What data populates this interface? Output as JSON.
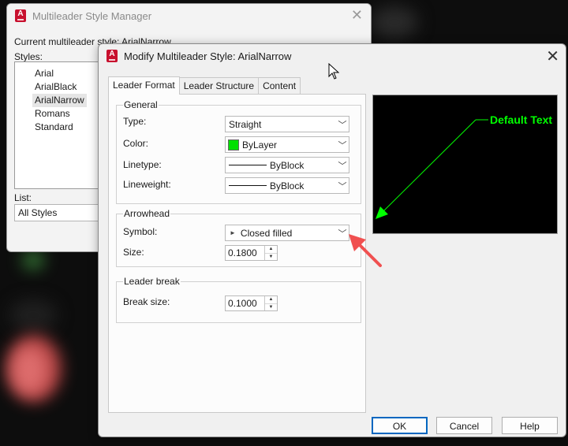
{
  "back_window": {
    "title": "Multileader Style Manager",
    "current_style_text": "Current multileader style: ArialNarrow",
    "styles_label": "Styles:",
    "styles": [
      "Arial",
      "ArialBlack",
      "ArialNarrow",
      "Romans",
      "Standard"
    ],
    "selected_style": "ArialNarrow",
    "list_label": "List:",
    "list_value": "All Styles"
  },
  "dialog": {
    "title": "Modify Multileader Style: ArialNarrow",
    "tabs": [
      "Leader Format",
      "Leader Structure",
      "Content"
    ],
    "active_tab": "Leader Format",
    "general": {
      "title": "General",
      "type_label": "Type:",
      "type_value": "Straight",
      "color_label": "Color:",
      "color_value": "ByLayer",
      "color_swatch": "#00e000",
      "linetype_label": "Linetype:",
      "linetype_value": "ByBlock",
      "lineweight_label": "Lineweight:",
      "lineweight_value": "ByBlock"
    },
    "arrowhead": {
      "title": "Arrowhead",
      "symbol_label": "Symbol:",
      "symbol_value": "Closed filled",
      "size_label": "Size:",
      "size_value": "0.1800"
    },
    "leader_break": {
      "title": "Leader break",
      "break_size_label": "Break size:",
      "break_size_value": "0.1000"
    },
    "preview": {
      "text": "Default Text",
      "color": "#00ff00"
    },
    "buttons": {
      "ok": "OK",
      "cancel": "Cancel",
      "help": "Help"
    }
  },
  "colors": {
    "app_icon": "#c8102e",
    "accent": "#0067c0",
    "annotation_arrow": "#f05050"
  }
}
